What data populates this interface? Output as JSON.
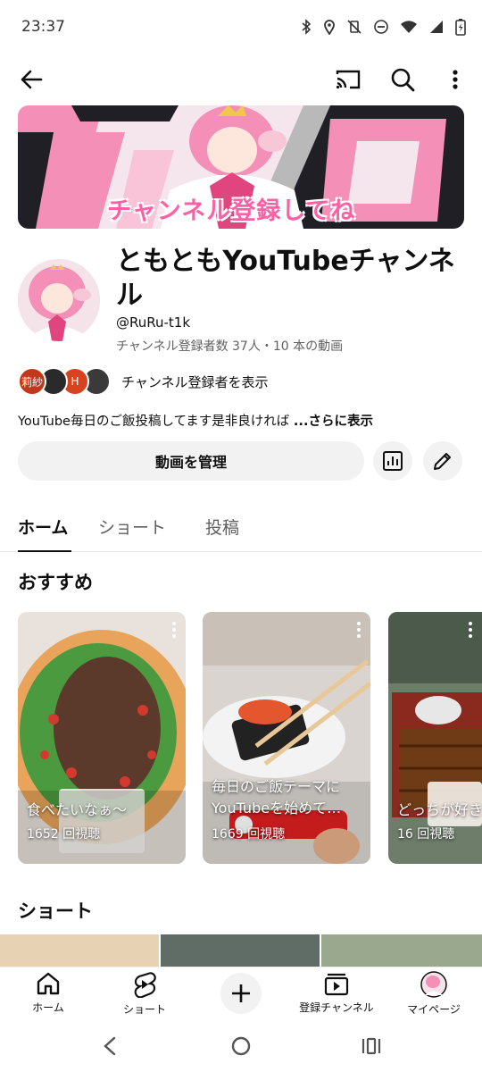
{
  "status": {
    "time": "23:37"
  },
  "banner": {
    "text": "チャンネル登録してね"
  },
  "channel": {
    "name": "ともともYouTubeチャンネル",
    "handle": "@RuRu-t1k",
    "stats": "チャンネル登録者数 37人・10 本の動画",
    "subscribers_label": "チャンネル登録者を表示",
    "subscriber_avatars": [
      {
        "label": "莉紗",
        "color": "#c0391b"
      },
      {
        "label": "",
        "color": "#2a2a2a"
      },
      {
        "label": "H",
        "color": "#d8431f"
      },
      {
        "label": "",
        "color": "#3a3a3a"
      }
    ],
    "description": "YouTube毎日のご飯投稿してます是非良ければ ",
    "description_more": "...さらに表示"
  },
  "actions": {
    "manage_label": "動画を管理"
  },
  "tabs": [
    {
      "label": "ホーム",
      "active": true
    },
    {
      "label": "ショート",
      "active": false
    },
    {
      "label": "投稿",
      "active": false
    }
  ],
  "sections": {
    "recommended": "おすすめ",
    "shorts": "ショート"
  },
  "recommended": [
    {
      "title": "食べたいなぁ〜",
      "views": "1652 回視聴"
    },
    {
      "title": "毎日のご飯テーマに YouTubeを始めて…",
      "views": "1669 回視聴"
    },
    {
      "title": "どっちが好き",
      "views": "16 回視聴"
    }
  ],
  "bottom_nav": [
    {
      "label": "ホーム"
    },
    {
      "label": "ショート"
    },
    {
      "label": ""
    },
    {
      "label": "登録チャンネル"
    },
    {
      "label": "マイページ"
    }
  ],
  "colors": {
    "accent_pink": "#ff5fa4",
    "text_primary": "#0f0f0f",
    "text_secondary": "#606060",
    "chip_bg": "#f2f2f2"
  }
}
